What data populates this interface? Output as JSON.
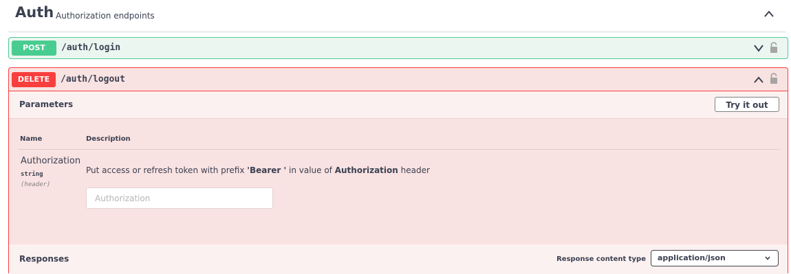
{
  "tag": {
    "name": "Auth",
    "description": "Authorization endpoints"
  },
  "operations": [
    {
      "method": "POST",
      "path": "/auth/login",
      "expanded": false,
      "color": "#49cc90"
    },
    {
      "method": "DELETE",
      "path": "/auth/logout",
      "expanded": true,
      "color": "#f93e3e"
    }
  ],
  "parameters_section": {
    "title": "Parameters",
    "try_label": "Try it out",
    "columns": [
      "Name",
      "Description"
    ],
    "params": [
      {
        "name": "Authorization",
        "type": "string",
        "in": "(header)",
        "desc_pre": "Put access or refresh token with prefix ",
        "desc_bold1": "'Bearer '",
        "desc_mid": " in value of ",
        "desc_bold2": "Authorization",
        "desc_post": " header",
        "placeholder": "Authorization"
      }
    ]
  },
  "responses_section": {
    "title": "Responses",
    "content_type_label": "Response content type",
    "content_type_value": "application/json"
  },
  "icons": {
    "collapse": "chevron-up-icon",
    "expand": "chevron-down-icon",
    "lock": "lock-icon",
    "select_caret": "chevron-down-icon"
  }
}
